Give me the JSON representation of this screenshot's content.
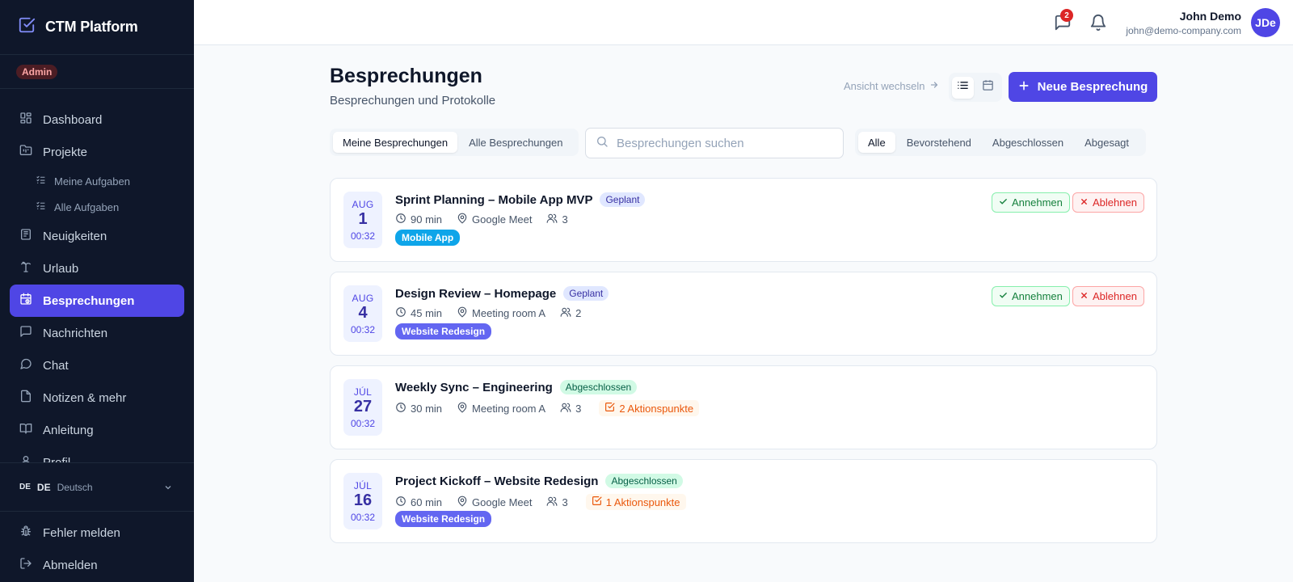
{
  "app": {
    "name": "CTM Platform",
    "role_badge": "Admin"
  },
  "sidebar": {
    "items": [
      {
        "label": "Dashboard",
        "icon": "dashboard-icon"
      },
      {
        "label": "Projekte",
        "icon": "folder-icon"
      },
      {
        "label": "Meine Aufgaben",
        "icon": "list-icon",
        "sub": true
      },
      {
        "label": "Alle Aufgaben",
        "icon": "list-icon",
        "sub": true
      },
      {
        "label": "Neuigkeiten",
        "icon": "newspaper-icon"
      },
      {
        "label": "Urlaub",
        "icon": "palm-tree-icon"
      },
      {
        "label": "Besprechungen",
        "icon": "calendar-clock-icon",
        "active": true
      },
      {
        "label": "Nachrichten",
        "icon": "message-square-icon"
      },
      {
        "label": "Chat",
        "icon": "message-circle-icon"
      },
      {
        "label": "Notizen & mehr",
        "icon": "file-icon"
      },
      {
        "label": "Anleitung",
        "icon": "book-icon"
      },
      {
        "label": "Profil",
        "icon": "user-icon"
      }
    ],
    "language": {
      "flag": "DE",
      "code": "DE",
      "name": "Deutsch"
    },
    "bottom": {
      "report_bug": "Fehler melden",
      "logout": "Abmelden"
    }
  },
  "topbar": {
    "messages_badge": "2",
    "user_name": "John Demo",
    "user_email": "john@demo-company.com",
    "avatar_initials": "JDe"
  },
  "header": {
    "title": "Besprechungen",
    "subtitle": "Besprechungen und Protokolle",
    "view_hint": "Ansicht wechseln",
    "new_button": "Neue Besprechung"
  },
  "filters": {
    "scope": [
      "Meine Besprechungen",
      "Alle Besprechungen"
    ],
    "scope_selected": "Meine Besprechungen",
    "search_placeholder": "Besprechungen suchen",
    "status": [
      "Alle",
      "Bevorstehend",
      "Abgeschlossen",
      "Abgesagt"
    ],
    "status_selected": "Alle"
  },
  "meetings": [
    {
      "month": "AUG",
      "day": "1",
      "time": "00:32",
      "title": "Sprint Planning – Mobile App MVP",
      "status": "Geplant",
      "duration": "90 min",
      "location": "Google Meet",
      "participants": "3",
      "project": "Mobile App",
      "project_color": "#0ea5e9",
      "accept": "Annehmen",
      "decline": "Ablehnen"
    },
    {
      "month": "AUG",
      "day": "4",
      "time": "00:32",
      "title": "Design Review – Homepage",
      "status": "Geplant",
      "duration": "45 min",
      "location": "Meeting room A",
      "participants": "2",
      "project": "Website Redesign",
      "project_color": "#6366f1",
      "accept": "Annehmen",
      "decline": "Ablehnen"
    },
    {
      "month": "JÚL",
      "day": "27",
      "time": "00:32",
      "title": "Weekly Sync – Engineering",
      "status": "Abgeschlossen",
      "duration": "30 min",
      "location": "Meeting room A",
      "participants": "3",
      "action_items": "2 Aktionspunkte"
    },
    {
      "month": "JÚL",
      "day": "16",
      "time": "00:32",
      "title": "Project Kickoff – Website Redesign",
      "status": "Abgeschlossen",
      "duration": "60 min",
      "location": "Google Meet",
      "participants": "3",
      "action_items": "1 Aktionspunkte",
      "project": "Website Redesign",
      "project_color": "#6366f1"
    }
  ],
  "colors": {
    "accent": "#4f46e5",
    "sidebar_bg": "#0f172a",
    "page_bg": "#f8fafc"
  }
}
